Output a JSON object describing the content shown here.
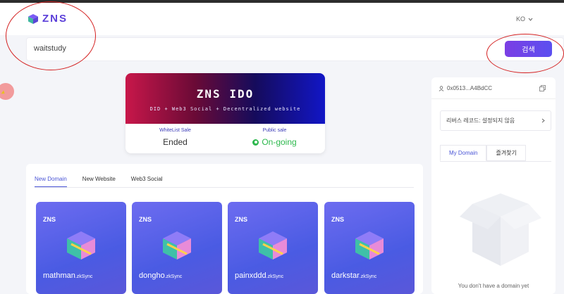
{
  "header": {
    "logo_text": "ZNS",
    "language": "KO"
  },
  "search": {
    "value": "waitstudy",
    "button_label": "검색"
  },
  "ido": {
    "title": "ZNS IDO",
    "subtitle": "DID + Web3 Social + Decentralized website",
    "whitelist_label": "WhiteList Sale",
    "whitelist_status": "Ended",
    "public_label": "Public sale",
    "public_status": "On-going"
  },
  "domains": {
    "tabs": [
      {
        "label": "New Domain"
      },
      {
        "label": "New Website"
      },
      {
        "label": "Web3 Social"
      }
    ],
    "cards": [
      {
        "brand": "ZNS",
        "name": "mathman",
        "suffix": ".zkSync"
      },
      {
        "brand": "ZNS",
        "name": "dongho",
        "suffix": ".zkSync"
      },
      {
        "brand": "ZNS",
        "name": "painxddd",
        "suffix": ".zkSync"
      },
      {
        "brand": "ZNS",
        "name": "darkstar",
        "suffix": ".zkSync"
      }
    ]
  },
  "sidebar": {
    "address": "0x0513...A4BdCC",
    "reverse_record": "리버스 레코드: 설정되지 않음",
    "tabs": [
      {
        "label": "My Domain"
      },
      {
        "label": "즐겨찾기"
      }
    ],
    "empty_text": "You don't have a domain yet"
  },
  "colors": {
    "accent": "#5b3fd9",
    "button": "#6a4ae8",
    "success": "#2db84d",
    "annotation": "#d42020"
  }
}
